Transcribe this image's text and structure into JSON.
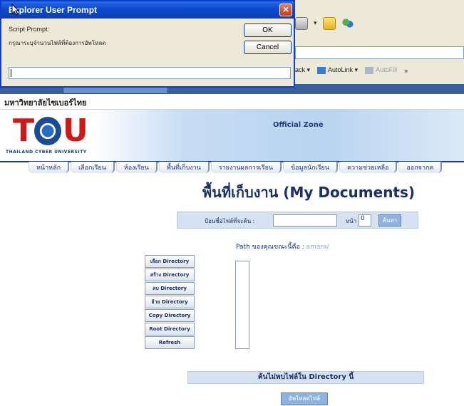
{
  "dialog": {
    "title": "Explorer User Prompt",
    "subtitle": "Script Prompt:",
    "message": "กรุณาระบุจำนวนไฟล์ที่ต้องการอัพโหลด",
    "ok_label": "OK",
    "cancel_label": "Cancel",
    "input_value": "",
    "close_glyph": "×"
  },
  "browser": {
    "links": [
      {
        "label": "ack ▾",
        "disabled": false
      },
      {
        "label": "AutoLink ▾",
        "disabled": false
      },
      {
        "label": "AutoFill",
        "disabled": true
      },
      {
        "label": "»",
        "disabled": false
      }
    ]
  },
  "site": {
    "university_name": "มหาวิทยาลัยไซเบอร์ไทย",
    "logo_text": {
      "t": "T",
      "u": "U"
    },
    "logo_sub": "THAILAND CYBER UNIVERSITY",
    "official_zone": "Official Zone",
    "menu": [
      "หน้าหลัก",
      "เลือกเรียน",
      "ห้องเรียน",
      "พื้นที่เก็บงาน",
      "รายงานผลการเรียน",
      "ข้อมูลนักเรียน",
      "ความช่วยเหลือ",
      "ออกจากค"
    ],
    "page_title": "พื้นที่เก็บงาน (My Documents)",
    "search": {
      "label": "ป้อนชื่อไฟล์ที่จะค้น :",
      "input_value": "",
      "page_label": "หน้า",
      "page_value": "0",
      "button_label": "ค้นหา"
    },
    "path": {
      "label": "Path ของคุณขณะนี้คือ :",
      "value": "amara/"
    },
    "dir_buttons": [
      "เลือก Directory",
      "สร้าง Directory",
      "ลบ Directory",
      "ย้าย Directory",
      "Copy Directory",
      "Root Directory",
      "Refresh"
    ],
    "search_in_dir": "ค้นไม่พบไฟล์ใน Directory นี้",
    "upload_button": "อัพโหลดไฟล์"
  }
}
